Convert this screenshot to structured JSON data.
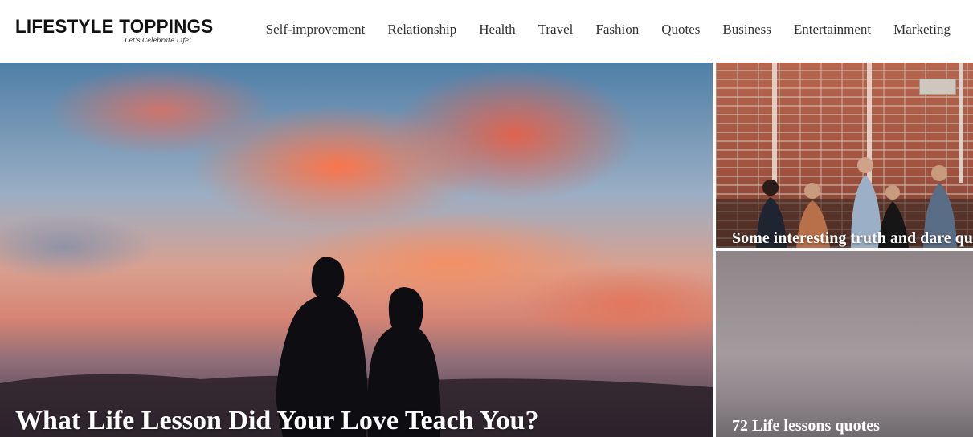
{
  "site": {
    "logo_text": "LIFESTYLE TOPPINGS",
    "tagline": "Let's Celebrate Life!"
  },
  "nav": {
    "items": [
      {
        "label": "Self-improvement"
      },
      {
        "label": "Relationship"
      },
      {
        "label": "Health"
      },
      {
        "label": "Travel"
      },
      {
        "label": "Fashion"
      },
      {
        "label": "Quotes"
      },
      {
        "label": "Business"
      },
      {
        "label": "Entertainment"
      },
      {
        "label": "Marketing"
      }
    ]
  },
  "featured": {
    "main": {
      "title": "What Life Lesson Did Your Love Teach You?"
    },
    "side_top": {
      "title": "Some interesting truth and dare questions"
    },
    "side_bottom": {
      "title": "72 Life lessons quotes"
    }
  },
  "colors": {
    "nav_text": "#333333",
    "title_text": "#ffffff",
    "background": "#ffffff"
  }
}
